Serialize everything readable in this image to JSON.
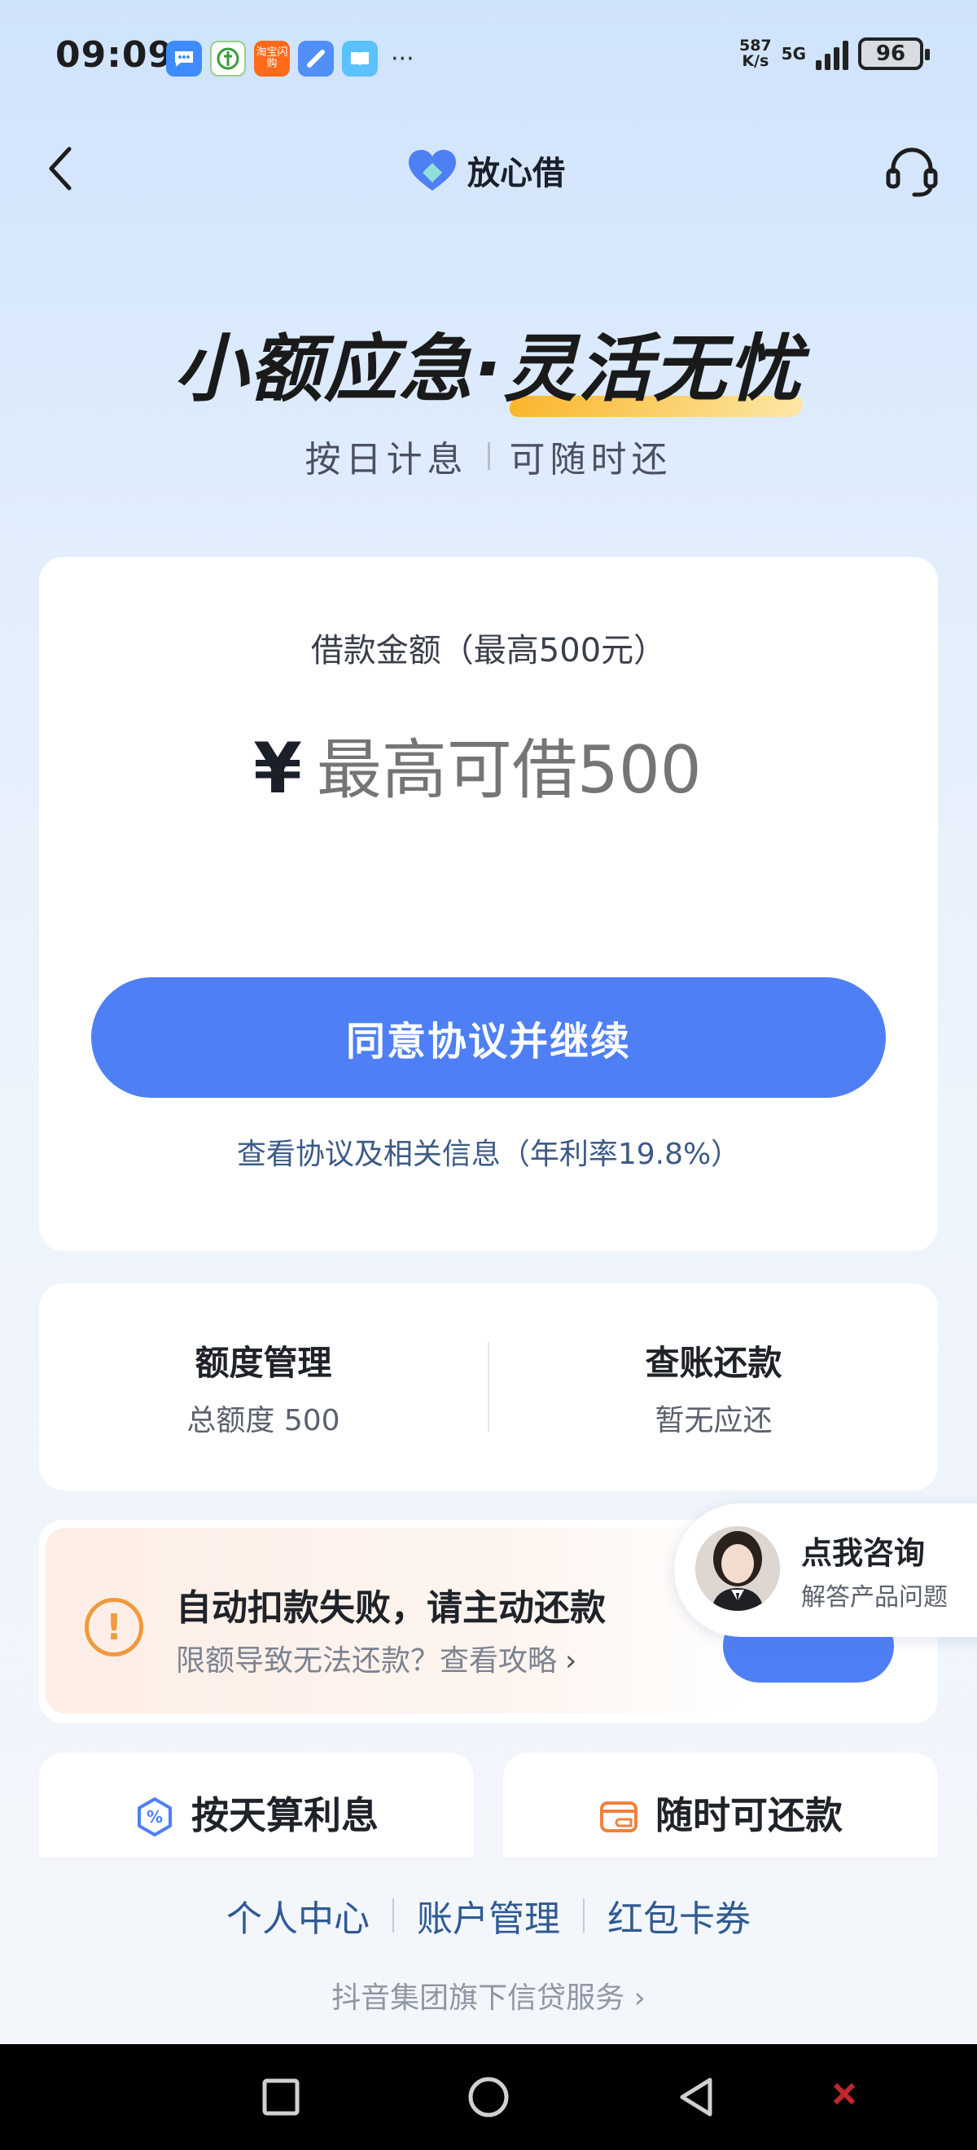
{
  "status_bar": {
    "time": "09:09",
    "net_speed_value": "587",
    "net_speed_unit": "K/s",
    "network": "5G",
    "battery": "96",
    "more": "···",
    "notif_taobao": "淘宝闪购"
  },
  "nav": {
    "brand_name": "放心借",
    "brand_color": "#4e7ff5"
  },
  "hero": {
    "title_part1": "小额应急·",
    "title_part2": "灵活无忧",
    "sub_left": "按日计息",
    "sub_right": "可随时还"
  },
  "loan": {
    "label": "借款金额（最高500元）",
    "currency": "¥",
    "placeholder": "最高可借500",
    "agree_button": "同意协议并继续",
    "agreement_link": "查看协议及相关信息（年利率19.8%）"
  },
  "quick": {
    "limit_title": "额度管理",
    "limit_sub": "总额度 500",
    "bill_title": "查账还款",
    "bill_sub": "暂无应还"
  },
  "notice": {
    "title": "自动扣款失败，请主动还款",
    "sub": "限额导致无法还款？查看攻略",
    "chevron": "›"
  },
  "consult": {
    "title": "点我咨询",
    "sub": "解答产品问题"
  },
  "features": {
    "f1": "按天算利息",
    "f2": "随时可还款"
  },
  "footer": {
    "links": [
      "个人中心",
      "账户管理",
      "红包卡券"
    ],
    "group_note": "抖音集团旗下信贷服务 ›"
  },
  "colors": {
    "accent": "#4e7ff5",
    "warning": "#f09a3e"
  }
}
